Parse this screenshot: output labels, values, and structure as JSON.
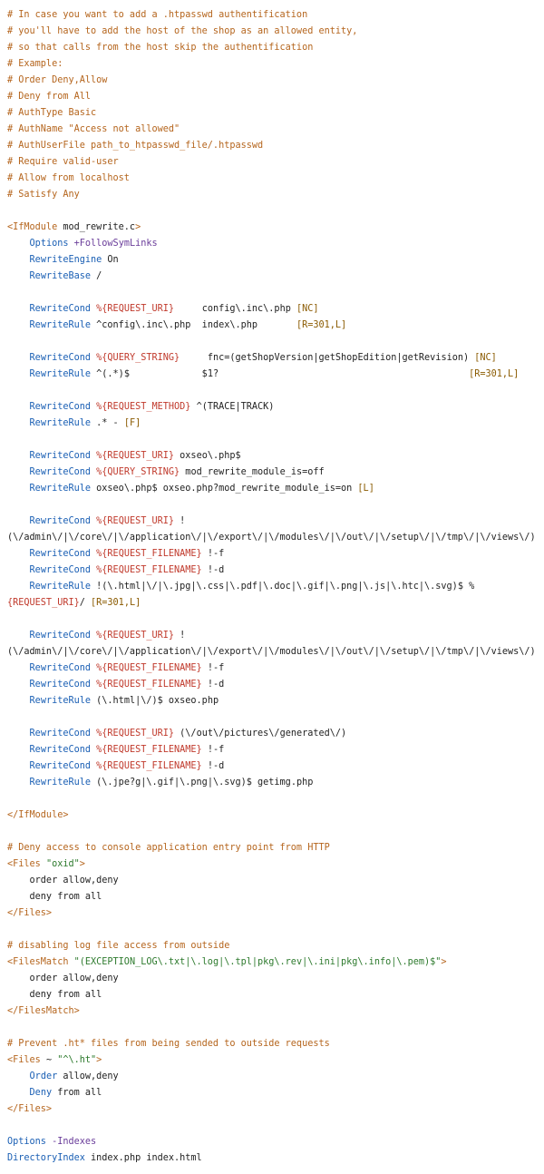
{
  "lines": [
    [
      [
        "com",
        "# In case you want to add a .htpasswd authentification"
      ]
    ],
    [
      [
        "com",
        "# you'll have to add the host of the shop as an allowed entity,"
      ]
    ],
    [
      [
        "com",
        "# so that calls from the host skip the authentification"
      ]
    ],
    [
      [
        "com",
        "# Example:"
      ]
    ],
    [
      [
        "com",
        "# Order Deny,Allow"
      ]
    ],
    [
      [
        "com",
        "# Deny from All"
      ]
    ],
    [
      [
        "com",
        "# AuthType Basic"
      ]
    ],
    [
      [
        "com",
        "# AuthName \"Access not allowed\""
      ]
    ],
    [
      [
        "com",
        "# AuthUserFile path_to_htpasswd_file/.htpasswd"
      ]
    ],
    [
      [
        "com",
        "# Require valid-user"
      ]
    ],
    [
      [
        "com",
        "# Allow from localhost"
      ]
    ],
    [
      [
        "com",
        "# Satisfy Any"
      ]
    ],
    [],
    [
      [
        "tag",
        "<IfModule"
      ],
      [
        "text",
        " mod_rewrite.c"
      ],
      [
        "tag",
        ">"
      ]
    ],
    [
      [
        "text",
        "    "
      ],
      [
        "kw",
        "Options"
      ],
      [
        "text",
        " "
      ],
      [
        "op",
        "+FollowSymLinks"
      ]
    ],
    [
      [
        "text",
        "    "
      ],
      [
        "kw",
        "RewriteEngine"
      ],
      [
        "text",
        " On"
      ]
    ],
    [
      [
        "text",
        "    "
      ],
      [
        "kw",
        "RewriteBase"
      ],
      [
        "text",
        " /"
      ]
    ],
    [],
    [
      [
        "text",
        "    "
      ],
      [
        "kw",
        "RewriteCond"
      ],
      [
        "text",
        " "
      ],
      [
        "var",
        "%{REQUEST_URI}"
      ],
      [
        "text",
        "     config\\.inc\\.php "
      ],
      [
        "flag",
        "[NC]"
      ]
    ],
    [
      [
        "text",
        "    "
      ],
      [
        "kw",
        "RewriteRule"
      ],
      [
        "text",
        " ^config\\.inc\\.php  index\\.php       "
      ],
      [
        "flag",
        "[R=301,L]"
      ]
    ],
    [],
    [
      [
        "text",
        "    "
      ],
      [
        "kw",
        "RewriteCond"
      ],
      [
        "text",
        " "
      ],
      [
        "var",
        "%{QUERY_STRING}"
      ],
      [
        "text",
        "     fnc=(getShopVersion|getShopEdition|getRevision) "
      ],
      [
        "flag",
        "[NC]"
      ]
    ],
    [
      [
        "text",
        "    "
      ],
      [
        "kw",
        "RewriteRule"
      ],
      [
        "text",
        " ^(.*)$             $1?                                             "
      ],
      [
        "flag",
        "[R=301,L]"
      ]
    ],
    [],
    [
      [
        "text",
        "    "
      ],
      [
        "kw",
        "RewriteCond"
      ],
      [
        "text",
        " "
      ],
      [
        "var",
        "%{REQUEST_METHOD}"
      ],
      [
        "text",
        " ^(TRACE|TRACK)"
      ]
    ],
    [
      [
        "text",
        "    "
      ],
      [
        "kw",
        "RewriteRule"
      ],
      [
        "text",
        " .* - "
      ],
      [
        "flag",
        "[F]"
      ]
    ],
    [],
    [
      [
        "text",
        "    "
      ],
      [
        "kw",
        "RewriteCond"
      ],
      [
        "text",
        " "
      ],
      [
        "var",
        "%{REQUEST_URI}"
      ],
      [
        "text",
        " oxseo\\.php$"
      ]
    ],
    [
      [
        "text",
        "    "
      ],
      [
        "kw",
        "RewriteCond"
      ],
      [
        "text",
        " "
      ],
      [
        "var",
        "%{QUERY_STRING}"
      ],
      [
        "text",
        " mod_rewrite_module_is=off"
      ]
    ],
    [
      [
        "text",
        "    "
      ],
      [
        "kw",
        "RewriteRule"
      ],
      [
        "text",
        " oxseo\\.php$ oxseo.php?mod_rewrite_module_is=on "
      ],
      [
        "flag",
        "[L]"
      ]
    ],
    [],
    [
      [
        "text",
        "    "
      ],
      [
        "kw",
        "RewriteCond"
      ],
      [
        "text",
        " "
      ],
      [
        "var",
        "%{REQUEST_URI}"
      ],
      [
        "text",
        " !"
      ]
    ],
    [
      [
        "text",
        "(\\/admin\\/|\\/core\\/|\\/application\\/|\\/export\\/|\\/modules\\/|\\/out\\/|\\/setup\\/|\\/tmp\\/|\\/views\\/)"
      ]
    ],
    [
      [
        "text",
        "    "
      ],
      [
        "kw",
        "RewriteCond"
      ],
      [
        "text",
        " "
      ],
      [
        "var",
        "%{REQUEST_FILENAME}"
      ],
      [
        "text",
        " !-f"
      ]
    ],
    [
      [
        "text",
        "    "
      ],
      [
        "kw",
        "RewriteCond"
      ],
      [
        "text",
        " "
      ],
      [
        "var",
        "%{REQUEST_FILENAME}"
      ],
      [
        "text",
        " !-d"
      ]
    ],
    [
      [
        "text",
        "    "
      ],
      [
        "kw",
        "RewriteRule"
      ],
      [
        "text",
        " !(\\.html|\\/|\\.jpg|\\.css|\\.pdf|\\.doc|\\.gif|\\.png|\\.js|\\.htc|\\.svg)$ %"
      ]
    ],
    [
      [
        "var",
        "{REQUEST_URI}"
      ],
      [
        "text",
        "/ "
      ],
      [
        "flag",
        "[R=301,L]"
      ]
    ],
    [],
    [
      [
        "text",
        "    "
      ],
      [
        "kw",
        "RewriteCond"
      ],
      [
        "text",
        " "
      ],
      [
        "var",
        "%{REQUEST_URI}"
      ],
      [
        "text",
        " !"
      ]
    ],
    [
      [
        "text",
        "(\\/admin\\/|\\/core\\/|\\/application\\/|\\/export\\/|\\/modules\\/|\\/out\\/|\\/setup\\/|\\/tmp\\/|\\/views\\/)"
      ]
    ],
    [
      [
        "text",
        "    "
      ],
      [
        "kw",
        "RewriteCond"
      ],
      [
        "text",
        " "
      ],
      [
        "var",
        "%{REQUEST_FILENAME}"
      ],
      [
        "text",
        " !-f"
      ]
    ],
    [
      [
        "text",
        "    "
      ],
      [
        "kw",
        "RewriteCond"
      ],
      [
        "text",
        " "
      ],
      [
        "var",
        "%{REQUEST_FILENAME}"
      ],
      [
        "text",
        " !-d"
      ]
    ],
    [
      [
        "text",
        "    "
      ],
      [
        "kw",
        "RewriteRule"
      ],
      [
        "text",
        " (\\.html|\\/)$ oxseo.php"
      ]
    ],
    [],
    [
      [
        "text",
        "    "
      ],
      [
        "kw",
        "RewriteCond"
      ],
      [
        "text",
        " "
      ],
      [
        "var",
        "%{REQUEST_URI}"
      ],
      [
        "text",
        " (\\/out\\/pictures\\/generated\\/)"
      ]
    ],
    [
      [
        "text",
        "    "
      ],
      [
        "kw",
        "RewriteCond"
      ],
      [
        "text",
        " "
      ],
      [
        "var",
        "%{REQUEST_FILENAME}"
      ],
      [
        "text",
        " !-f"
      ]
    ],
    [
      [
        "text",
        "    "
      ],
      [
        "kw",
        "RewriteCond"
      ],
      [
        "text",
        " "
      ],
      [
        "var",
        "%{REQUEST_FILENAME}"
      ],
      [
        "text",
        " !-d"
      ]
    ],
    [
      [
        "text",
        "    "
      ],
      [
        "kw",
        "RewriteRule"
      ],
      [
        "text",
        " (\\.jpe?g|\\.gif|\\.png|\\.svg)$ getimg.php"
      ]
    ],
    [],
    [
      [
        "tag",
        "</IfModule>"
      ]
    ],
    [],
    [
      [
        "com",
        "# Deny access to console application entry point from HTTP"
      ]
    ],
    [
      [
        "tag",
        "<Files"
      ],
      [
        "text",
        " "
      ],
      [
        "str",
        "\"oxid\""
      ],
      [
        "tag",
        ">"
      ]
    ],
    [
      [
        "text",
        "    order allow,deny"
      ]
    ],
    [
      [
        "text",
        "    deny from all"
      ]
    ],
    [
      [
        "tag",
        "</Files>"
      ]
    ],
    [],
    [
      [
        "com",
        "# disabling log file access from outside"
      ]
    ],
    [
      [
        "tag",
        "<FilesMatch"
      ],
      [
        "text",
        " "
      ],
      [
        "str",
        "\"(EXCEPTION_LOG\\.txt|\\.log|\\.tpl|pkg\\.rev|\\.ini|pkg\\.info|\\.pem)$\""
      ],
      [
        "tag",
        ">"
      ]
    ],
    [
      [
        "text",
        "    order allow,deny"
      ]
    ],
    [
      [
        "text",
        "    deny from all"
      ]
    ],
    [
      [
        "tag",
        "</FilesMatch>"
      ]
    ],
    [],
    [
      [
        "com",
        "# Prevent .ht* files from being sended to outside requests"
      ]
    ],
    [
      [
        "tag",
        "<Files"
      ],
      [
        "text",
        " ~ "
      ],
      [
        "str",
        "\"^\\.ht\""
      ],
      [
        "tag",
        ">"
      ]
    ],
    [
      [
        "text",
        "    "
      ],
      [
        "kw",
        "Order"
      ],
      [
        "text",
        " allow,deny"
      ]
    ],
    [
      [
        "text",
        "    "
      ],
      [
        "kw",
        "Deny"
      ],
      [
        "text",
        " from all"
      ]
    ],
    [
      [
        "tag",
        "</Files>"
      ]
    ],
    [],
    [
      [
        "kw",
        "Options"
      ],
      [
        "text",
        " "
      ],
      [
        "op",
        "-Indexes"
      ]
    ],
    [
      [
        "kw",
        "DirectoryIndex"
      ],
      [
        "text",
        " index.php index.html"
      ]
    ]
  ]
}
